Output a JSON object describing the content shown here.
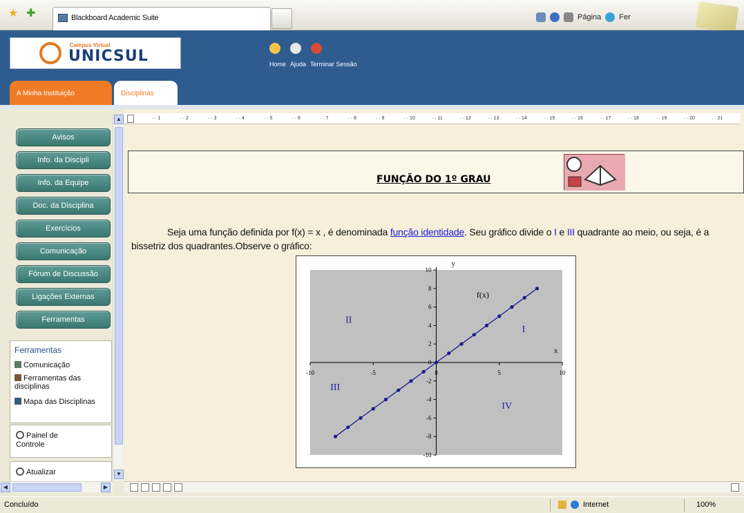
{
  "browser": {
    "tab_title": "Blackboard Academic Suite",
    "commands": [
      "Página",
      "Fer"
    ],
    "status_text": "Concluído",
    "zone": "Internet",
    "zoom": "100%"
  },
  "site": {
    "logo_small": "Campus Virtual",
    "logo_text": "UNICSUL",
    "header_links": [
      "Home",
      "Ajuda",
      "Terminar Sessão"
    ],
    "tabs": [
      {
        "label": "A Minha Instituição"
      },
      {
        "label": "Disciplinas"
      }
    ]
  },
  "nav": {
    "buttons": [
      "Avisos",
      "Info. da Discipli",
      "Info. da Equipe",
      "Doc. da Disciplina",
      "Exercícios",
      "Comunicação",
      "Fórum de Discussão",
      "Ligações Externas",
      "Ferramentas"
    ],
    "tools_title": "Ferramentas",
    "tools_items": [
      "Comunicação",
      "Ferramentas das disciplinas",
      "Mapa das Disciplinas"
    ],
    "panel_label": "Painel de Controle",
    "refresh_label": "Atualizar"
  },
  "content": {
    "ruler_marks": [
      "1",
      "2",
      "3",
      "4",
      "5",
      "6",
      "7",
      "8",
      "9",
      "10",
      "11",
      "12",
      "13",
      "14",
      "15",
      "16",
      "17",
      "18",
      "19",
      "20",
      "21"
    ],
    "title": "FUNÇÃO DO 1º GRAU",
    "para_part1": "Seja uma função definida por f(x) = x  , é denominada ",
    "para_link": "função identidade",
    "para_part2": ". Seu gráfico divide o ",
    "para_q1": "I",
    "para_mid": " e ",
    "para_q3": "III",
    "para_part3": " quadrante ao meio, ou seja, é a bissetriz dos quadrantes.Observe o gráfico:"
  },
  "chart_data": {
    "type": "scatter",
    "series": [
      {
        "values": [
          [
            -8,
            -8
          ],
          [
            -7,
            -7
          ],
          [
            -6,
            -6
          ],
          [
            -5,
            -5
          ],
          [
            -4,
            -4
          ],
          [
            -3,
            -3
          ],
          [
            -2,
            -2
          ],
          [
            -1,
            -1
          ],
          [
            0,
            0
          ],
          [
            1,
            1
          ],
          [
            2,
            2
          ],
          [
            3,
            3
          ],
          [
            4,
            4
          ],
          [
            5,
            5
          ],
          [
            6,
            6
          ],
          [
            7,
            7
          ],
          [
            8,
            8
          ]
        ]
      }
    ],
    "xlim": [
      -10,
      10
    ],
    "ylim": [
      -10,
      10
    ],
    "x_ticks": [
      "-10",
      "-5",
      "0",
      "5",
      "10"
    ],
    "y_ticks": [
      "10",
      "8",
      "6",
      "4",
      "2",
      "0",
      "-2",
      "-4",
      "-6",
      "-8",
      "-10"
    ],
    "xlabel": "x",
    "ylabel": "y",
    "annotations": [
      "f(x)",
      "I",
      "II",
      "III",
      "IV"
    ],
    "colors": {
      "plot_bg": "#c0c0c0",
      "line": "#1a1a8c"
    }
  }
}
